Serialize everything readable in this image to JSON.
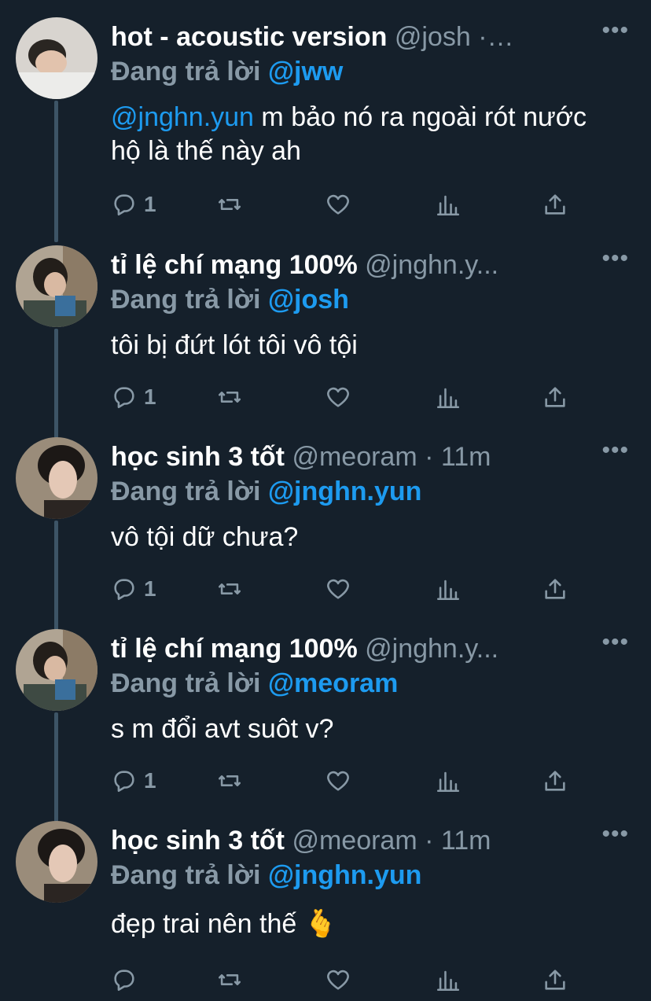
{
  "colors": {
    "background": "#15202b",
    "secondary": "#8899a6",
    "accent": "#1d9bf0",
    "text": "#ffffff"
  },
  "tweets": [
    {
      "name": "hot - acoustic version",
      "handle": "@josh",
      "meta": " ·…",
      "reply_label": "Đang trả lời ",
      "reply_handle": "@jww",
      "mention": "@jnghn.yun",
      "text": " m bảo nó ra ngoài rót nước hộ là thế này ah",
      "replies": "1",
      "avatar": "avatar-photo"
    },
    {
      "name": "tỉ lệ chí mạng 100%",
      "handle": "@jnghn.y...",
      "meta": "",
      "reply_label": "Đang trả lời ",
      "reply_handle": "@josh",
      "mention": "",
      "text": "tôi bị đứt lót tôi vô tội",
      "replies": "1",
      "avatar": "avatar-photo"
    },
    {
      "name": "học sinh 3 tốt",
      "handle": "@meoram",
      "meta": " · 11m",
      "reply_label": "Đang trả lời ",
      "reply_handle": "@jnghn.yun",
      "mention": "",
      "text": "vô tội dữ chưa?",
      "replies": "1",
      "avatar": "avatar-photo"
    },
    {
      "name": "tỉ lệ chí mạng 100%",
      "handle": "@jnghn.y...",
      "meta": "",
      "reply_label": "Đang trả lời ",
      "reply_handle": "@meoram",
      "mention": "",
      "text": "s m đổi avt suôt v?",
      "replies": "1",
      "avatar": "avatar-photo"
    },
    {
      "name": "học sinh 3 tốt",
      "handle": "@meoram",
      "meta": " · 11m",
      "reply_label": "Đang trả lời ",
      "reply_handle": "@jnghn.yun",
      "mention": "",
      "text": "đẹp trai nên thế 🫰",
      "replies": "",
      "avatar": "avatar-photo"
    }
  ],
  "icons": {
    "reply": "reply-icon",
    "retweet": "retweet-icon",
    "like": "heart-icon",
    "analytics": "analytics-icon",
    "share": "share-icon",
    "more": "more-icon"
  }
}
